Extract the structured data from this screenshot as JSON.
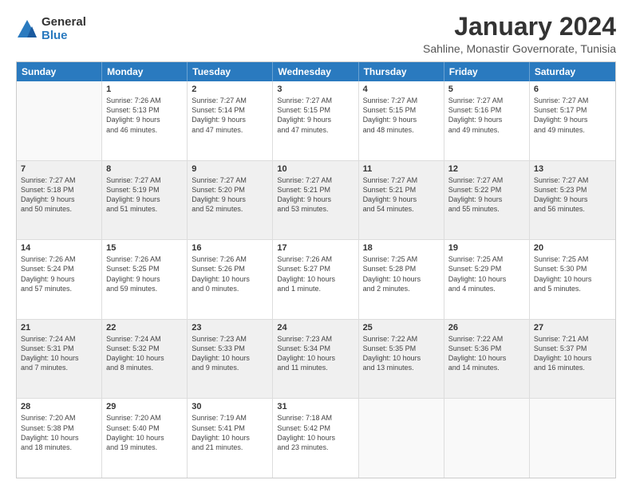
{
  "logo": {
    "general": "General",
    "blue": "Blue"
  },
  "title": "January 2024",
  "subtitle": "Sahline, Monastir Governorate, Tunisia",
  "calendar": {
    "headers": [
      "Sunday",
      "Monday",
      "Tuesday",
      "Wednesday",
      "Thursday",
      "Friday",
      "Saturday"
    ],
    "rows": [
      [
        {
          "date": "",
          "lines": []
        },
        {
          "date": "1",
          "lines": [
            "Sunrise: 7:26 AM",
            "Sunset: 5:13 PM",
            "Daylight: 9 hours",
            "and 46 minutes."
          ]
        },
        {
          "date": "2",
          "lines": [
            "Sunrise: 7:27 AM",
            "Sunset: 5:14 PM",
            "Daylight: 9 hours",
            "and 47 minutes."
          ]
        },
        {
          "date": "3",
          "lines": [
            "Sunrise: 7:27 AM",
            "Sunset: 5:15 PM",
            "Daylight: 9 hours",
            "and 47 minutes."
          ]
        },
        {
          "date": "4",
          "lines": [
            "Sunrise: 7:27 AM",
            "Sunset: 5:15 PM",
            "Daylight: 9 hours",
            "and 48 minutes."
          ]
        },
        {
          "date": "5",
          "lines": [
            "Sunrise: 7:27 AM",
            "Sunset: 5:16 PM",
            "Daylight: 9 hours",
            "and 49 minutes."
          ]
        },
        {
          "date": "6",
          "lines": [
            "Sunrise: 7:27 AM",
            "Sunset: 5:17 PM",
            "Daylight: 9 hours",
            "and 49 minutes."
          ]
        }
      ],
      [
        {
          "date": "7",
          "lines": [
            "Sunrise: 7:27 AM",
            "Sunset: 5:18 PM",
            "Daylight: 9 hours",
            "and 50 minutes."
          ]
        },
        {
          "date": "8",
          "lines": [
            "Sunrise: 7:27 AM",
            "Sunset: 5:19 PM",
            "Daylight: 9 hours",
            "and 51 minutes."
          ]
        },
        {
          "date": "9",
          "lines": [
            "Sunrise: 7:27 AM",
            "Sunset: 5:20 PM",
            "Daylight: 9 hours",
            "and 52 minutes."
          ]
        },
        {
          "date": "10",
          "lines": [
            "Sunrise: 7:27 AM",
            "Sunset: 5:21 PM",
            "Daylight: 9 hours",
            "and 53 minutes."
          ]
        },
        {
          "date": "11",
          "lines": [
            "Sunrise: 7:27 AM",
            "Sunset: 5:21 PM",
            "Daylight: 9 hours",
            "and 54 minutes."
          ]
        },
        {
          "date": "12",
          "lines": [
            "Sunrise: 7:27 AM",
            "Sunset: 5:22 PM",
            "Daylight: 9 hours",
            "and 55 minutes."
          ]
        },
        {
          "date": "13",
          "lines": [
            "Sunrise: 7:27 AM",
            "Sunset: 5:23 PM",
            "Daylight: 9 hours",
            "and 56 minutes."
          ]
        }
      ],
      [
        {
          "date": "14",
          "lines": [
            "Sunrise: 7:26 AM",
            "Sunset: 5:24 PM",
            "Daylight: 9 hours",
            "and 57 minutes."
          ]
        },
        {
          "date": "15",
          "lines": [
            "Sunrise: 7:26 AM",
            "Sunset: 5:25 PM",
            "Daylight: 9 hours",
            "and 59 minutes."
          ]
        },
        {
          "date": "16",
          "lines": [
            "Sunrise: 7:26 AM",
            "Sunset: 5:26 PM",
            "Daylight: 10 hours",
            "and 0 minutes."
          ]
        },
        {
          "date": "17",
          "lines": [
            "Sunrise: 7:26 AM",
            "Sunset: 5:27 PM",
            "Daylight: 10 hours",
            "and 1 minute."
          ]
        },
        {
          "date": "18",
          "lines": [
            "Sunrise: 7:25 AM",
            "Sunset: 5:28 PM",
            "Daylight: 10 hours",
            "and 2 minutes."
          ]
        },
        {
          "date": "19",
          "lines": [
            "Sunrise: 7:25 AM",
            "Sunset: 5:29 PM",
            "Daylight: 10 hours",
            "and 4 minutes."
          ]
        },
        {
          "date": "20",
          "lines": [
            "Sunrise: 7:25 AM",
            "Sunset: 5:30 PM",
            "Daylight: 10 hours",
            "and 5 minutes."
          ]
        }
      ],
      [
        {
          "date": "21",
          "lines": [
            "Sunrise: 7:24 AM",
            "Sunset: 5:31 PM",
            "Daylight: 10 hours",
            "and 7 minutes."
          ]
        },
        {
          "date": "22",
          "lines": [
            "Sunrise: 7:24 AM",
            "Sunset: 5:32 PM",
            "Daylight: 10 hours",
            "and 8 minutes."
          ]
        },
        {
          "date": "23",
          "lines": [
            "Sunrise: 7:23 AM",
            "Sunset: 5:33 PM",
            "Daylight: 10 hours",
            "and 9 minutes."
          ]
        },
        {
          "date": "24",
          "lines": [
            "Sunrise: 7:23 AM",
            "Sunset: 5:34 PM",
            "Daylight: 10 hours",
            "and 11 minutes."
          ]
        },
        {
          "date": "25",
          "lines": [
            "Sunrise: 7:22 AM",
            "Sunset: 5:35 PM",
            "Daylight: 10 hours",
            "and 13 minutes."
          ]
        },
        {
          "date": "26",
          "lines": [
            "Sunrise: 7:22 AM",
            "Sunset: 5:36 PM",
            "Daylight: 10 hours",
            "and 14 minutes."
          ]
        },
        {
          "date": "27",
          "lines": [
            "Sunrise: 7:21 AM",
            "Sunset: 5:37 PM",
            "Daylight: 10 hours",
            "and 16 minutes."
          ]
        }
      ],
      [
        {
          "date": "28",
          "lines": [
            "Sunrise: 7:20 AM",
            "Sunset: 5:38 PM",
            "Daylight: 10 hours",
            "and 18 minutes."
          ]
        },
        {
          "date": "29",
          "lines": [
            "Sunrise: 7:20 AM",
            "Sunset: 5:40 PM",
            "Daylight: 10 hours",
            "and 19 minutes."
          ]
        },
        {
          "date": "30",
          "lines": [
            "Sunrise: 7:19 AM",
            "Sunset: 5:41 PM",
            "Daylight: 10 hours",
            "and 21 minutes."
          ]
        },
        {
          "date": "31",
          "lines": [
            "Sunrise: 7:18 AM",
            "Sunset: 5:42 PM",
            "Daylight: 10 hours",
            "and 23 minutes."
          ]
        },
        {
          "date": "",
          "lines": []
        },
        {
          "date": "",
          "lines": []
        },
        {
          "date": "",
          "lines": []
        }
      ]
    ]
  }
}
